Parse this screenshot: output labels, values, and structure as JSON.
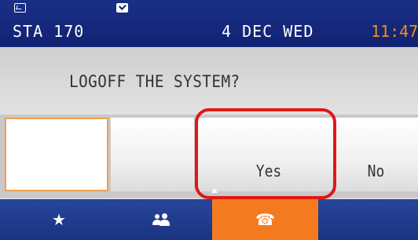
{
  "status_bar": {
    "station": "STA 170",
    "date": "4 DEC WED",
    "time": "11:47",
    "left_icon": "missed-call-icon",
    "mid_icon": "message-icon"
  },
  "prompt": {
    "text": "LOGOFF THE SYSTEM?"
  },
  "softkeys": [
    {
      "label": "",
      "selected": true
    },
    {
      "label": ""
    },
    {
      "label": "Yes",
      "highlighted": true
    },
    {
      "label": "No"
    }
  ],
  "nav": {
    "items": [
      {
        "icon": "star-icon",
        "glyph": "★"
      },
      {
        "icon": "contacts-icon"
      },
      {
        "icon": "phone-icon",
        "glyph": "☎",
        "active": true
      }
    ]
  },
  "colors": {
    "status_bar_bg": "#102272",
    "time_color": "#f09018",
    "active_nav": "#f47a20",
    "highlight_ring": "#e01818"
  }
}
